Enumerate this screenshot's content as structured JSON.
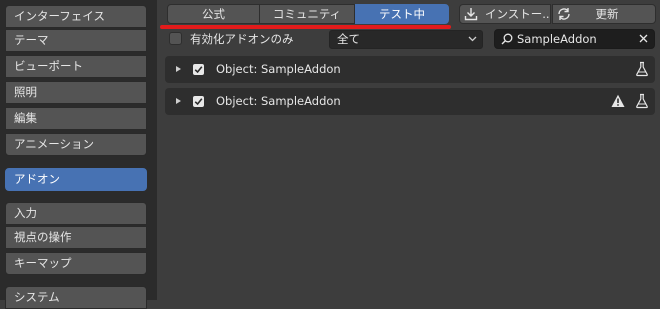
{
  "sidebar": {
    "items": [
      {
        "label": "インターフェイス"
      },
      {
        "label": "テーマ"
      },
      {
        "label": "ビューポート"
      },
      {
        "label": "照明"
      },
      {
        "label": "編集"
      },
      {
        "label": "アニメーション"
      },
      {
        "label": "アドオン",
        "active": true
      },
      {
        "label": "入力"
      },
      {
        "label": "視点の操作"
      },
      {
        "label": "キーマップ"
      },
      {
        "label": "システム"
      }
    ]
  },
  "toolbar": {
    "tabs": [
      {
        "label": "公式"
      },
      {
        "label": "コミュニティ"
      },
      {
        "label": "テスト中",
        "active": true
      }
    ],
    "install_label": "インストー..",
    "refresh_label": "更新"
  },
  "filters": {
    "enabled_only_label": "有効化アドオンのみ",
    "enabled_only_checked": false,
    "category_value": "全て",
    "search_value": "SampleAddon"
  },
  "addons": [
    {
      "name": "Object: SampleAddon",
      "enabled": true,
      "warning": false,
      "icon": "flask-icon"
    },
    {
      "name": "Object: SampleAddon",
      "enabled": true,
      "warning": true,
      "icon": "flask-icon"
    }
  ],
  "colors": {
    "accent": "#4772b3",
    "highlight_line": "#e21b1b",
    "background": "#3d3d3d",
    "sidebar_bg": "#2b2b2b"
  }
}
